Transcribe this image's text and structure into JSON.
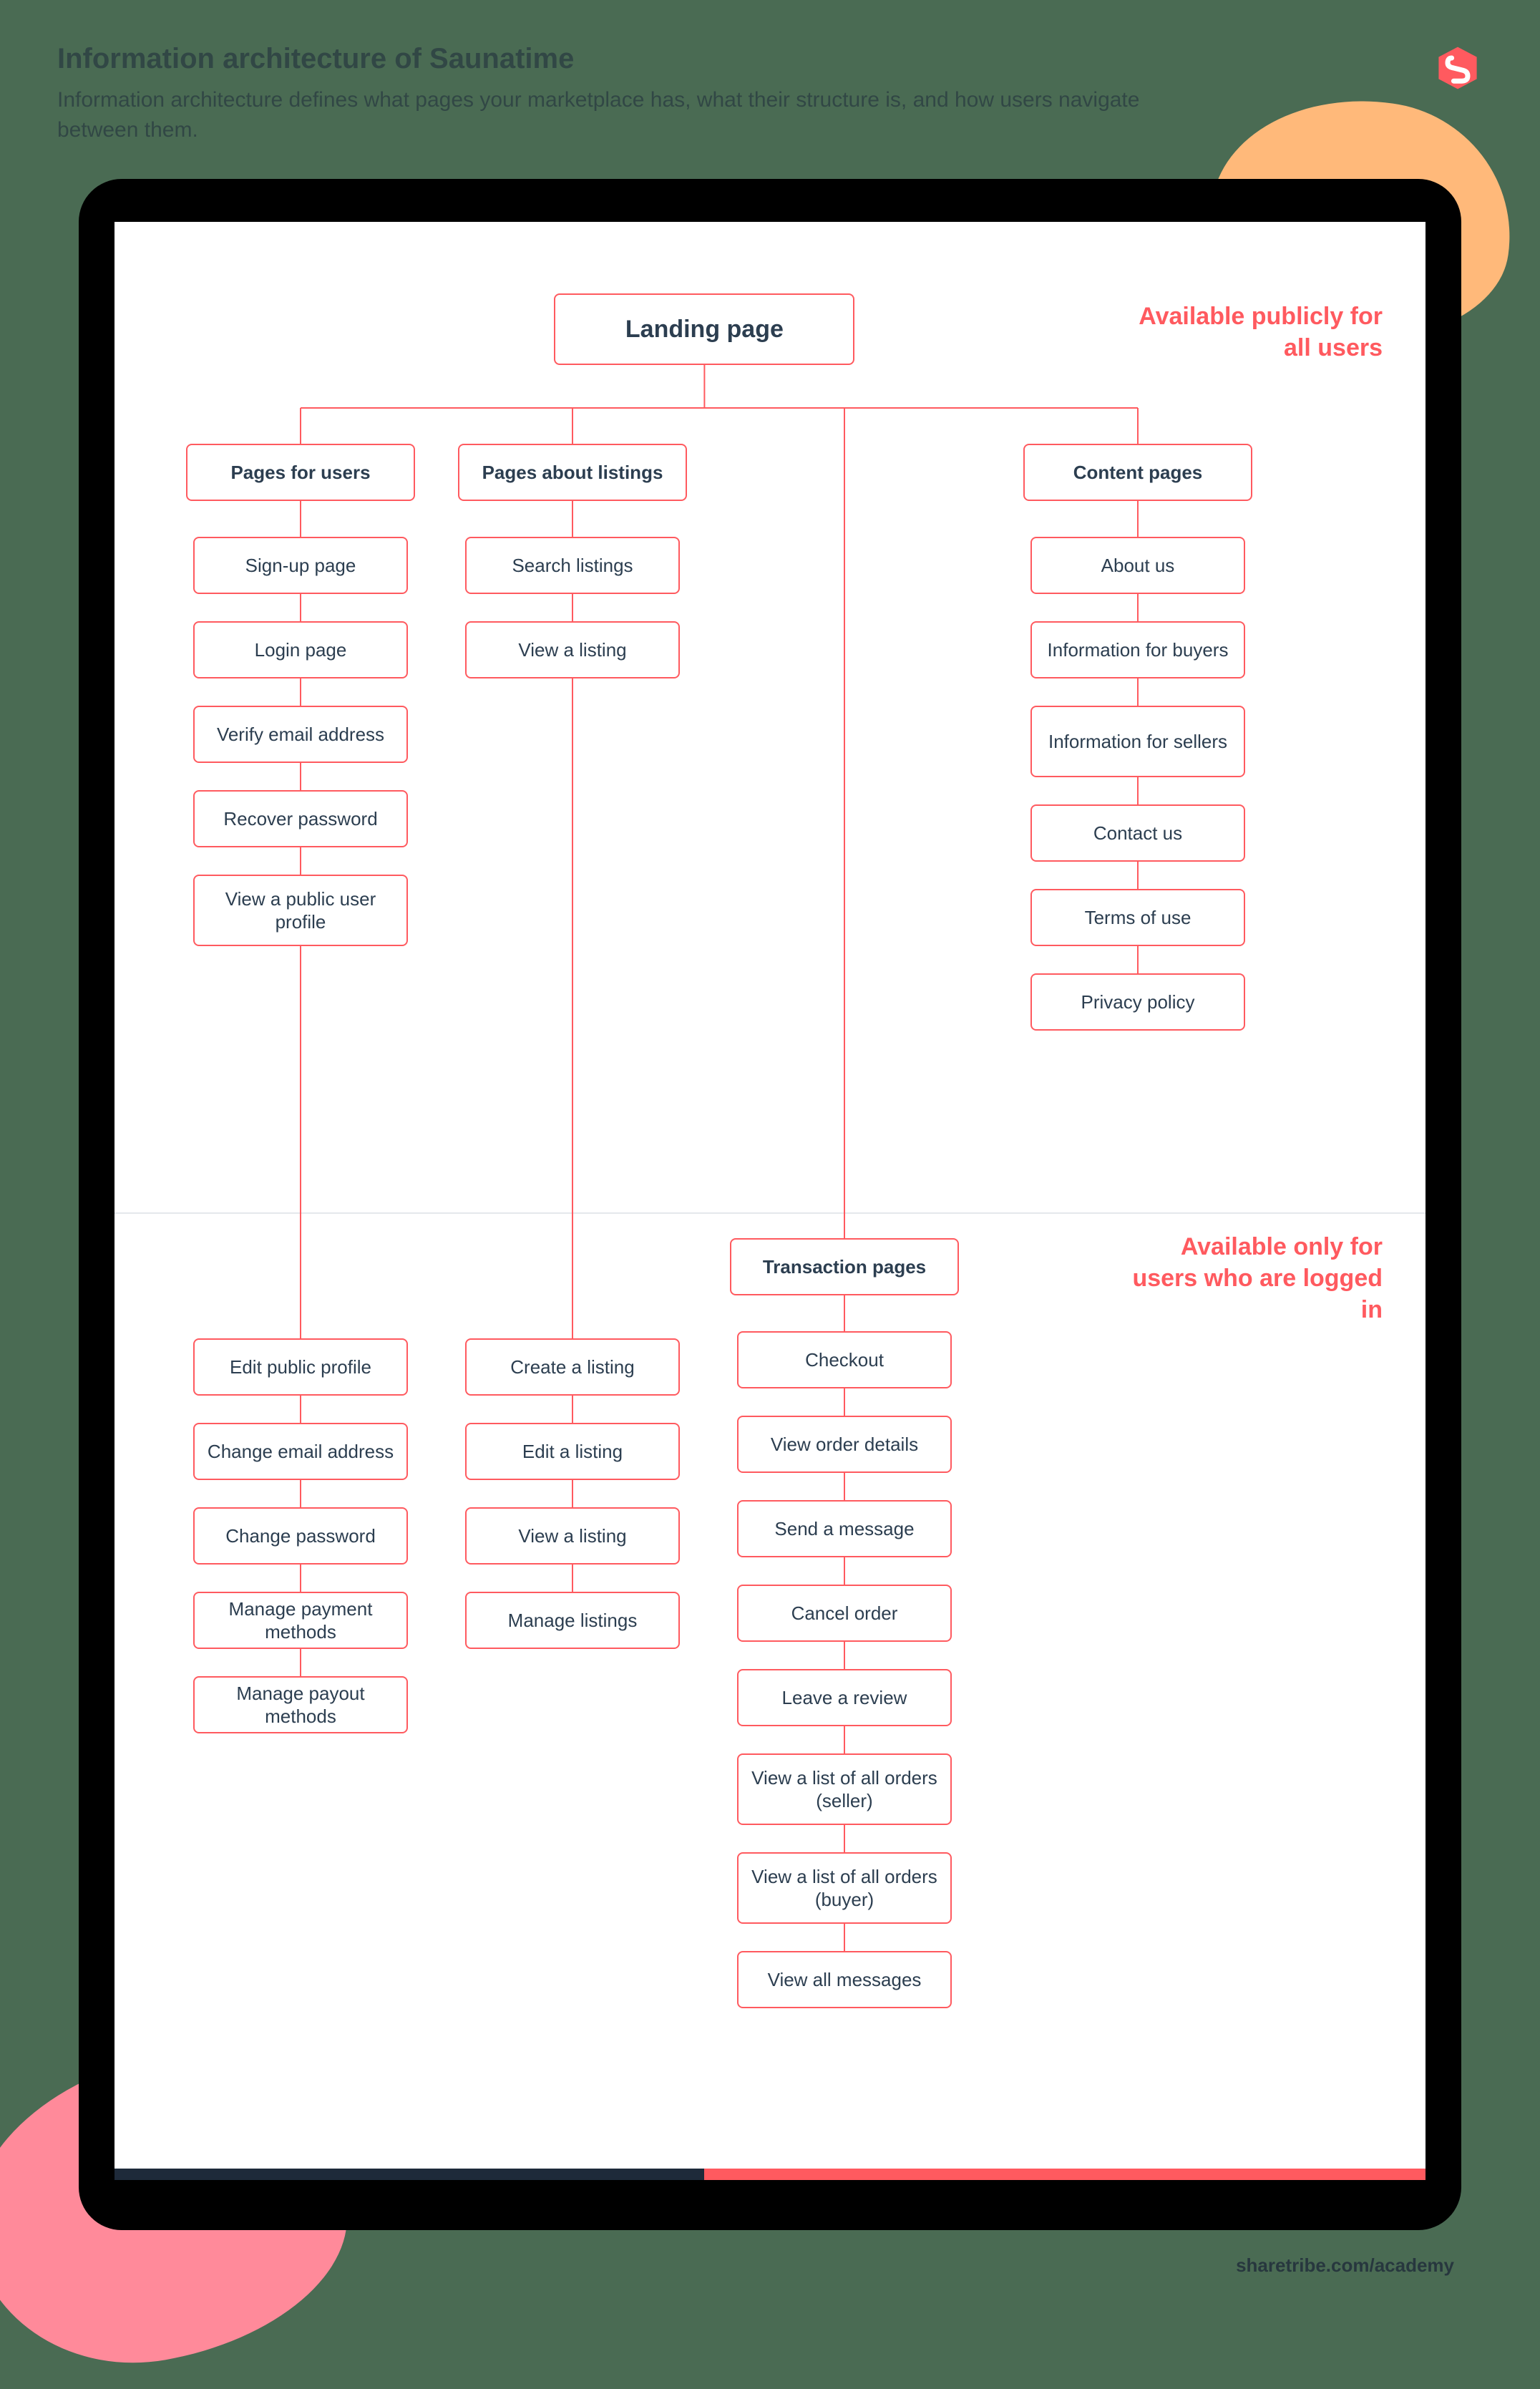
{
  "header": {
    "title": "Information architecture of Saunatime",
    "subtitle": "Information architecture defines what pages your marketplace has, what their structure is, and how users navigate between them."
  },
  "footer": {
    "url": "sharetribe.com/academy"
  },
  "labels": {
    "public": "Available publicly for all users",
    "loggedIn": "Available only for users who are logged in"
  },
  "diagram": {
    "root": "Landing page",
    "columns": {
      "users": {
        "header": "Pages for users",
        "public": [
          "Sign-up page",
          "Login page",
          "Verify email address",
          "Recover password",
          "View a public user profile"
        ],
        "private": [
          "Edit public profile",
          "Change email address",
          "Change password",
          "Manage payment methods",
          "Manage payout methods"
        ]
      },
      "listings": {
        "header": "Pages about listings",
        "public": [
          "Search listings",
          "View a listing"
        ],
        "private": [
          "Create a listing",
          "Edit a listing",
          "View a listing",
          "Manage listings"
        ]
      },
      "transactions": {
        "header": "Transaction pages",
        "private": [
          "Checkout",
          "View order details",
          "Send a message",
          "Cancel order",
          "Leave a review",
          "View a list of all orders (seller)",
          "View a list of all orders (buyer)",
          "View all messages"
        ]
      },
      "content": {
        "header": "Content pages",
        "public": [
          "About us",
          "Information for buyers",
          "Information for sellers",
          "Contact us",
          "Terms of use",
          "Privacy policy"
        ]
      }
    }
  }
}
